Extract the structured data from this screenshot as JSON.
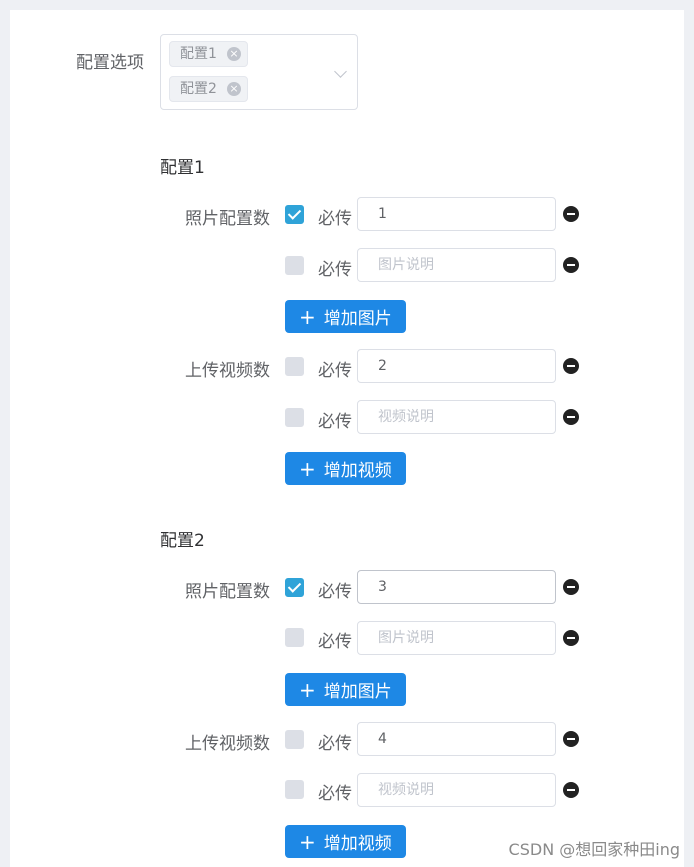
{
  "config_select": {
    "label": "配置选项",
    "tags": [
      "配置1",
      "配置2"
    ],
    "tag_close_glyph": "×"
  },
  "sections": [
    {
      "title": "配置1",
      "photo_label": "照片配置数",
      "photo_rows": [
        {
          "checked": true,
          "req_label": "必传",
          "value": "1",
          "placeholder": ""
        },
        {
          "checked": false,
          "req_label": "必传",
          "value": "",
          "placeholder": "图片说明"
        }
      ],
      "add_photo_button": "增加图片",
      "video_label": "上传视频数",
      "video_rows": [
        {
          "checked": false,
          "req_label": "必传",
          "value": "2",
          "placeholder": ""
        },
        {
          "checked": false,
          "req_label": "必传",
          "value": "",
          "placeholder": "视频说明"
        }
      ],
      "add_video_button": "增加视频"
    },
    {
      "title": "配置2",
      "photo_label": "照片配置数",
      "photo_rows": [
        {
          "checked": true,
          "req_label": "必传",
          "value": "3",
          "placeholder": ""
        },
        {
          "checked": false,
          "req_label": "必传",
          "value": "",
          "placeholder": "图片说明"
        }
      ],
      "add_photo_button": "增加图片",
      "video_label": "上传视频数",
      "video_rows": [
        {
          "checked": false,
          "req_label": "必传",
          "value": "4",
          "placeholder": ""
        },
        {
          "checked": false,
          "req_label": "必传",
          "value": "",
          "placeholder": "视频说明"
        }
      ],
      "add_video_button": "增加视频"
    }
  ],
  "plus_glyph": "+",
  "watermark": "CSDN @想回家种田ing",
  "colors": {
    "primary_button": "#1e88e5",
    "checkbox_checked": "#2fa3d8",
    "remove_icon": "#222222"
  }
}
